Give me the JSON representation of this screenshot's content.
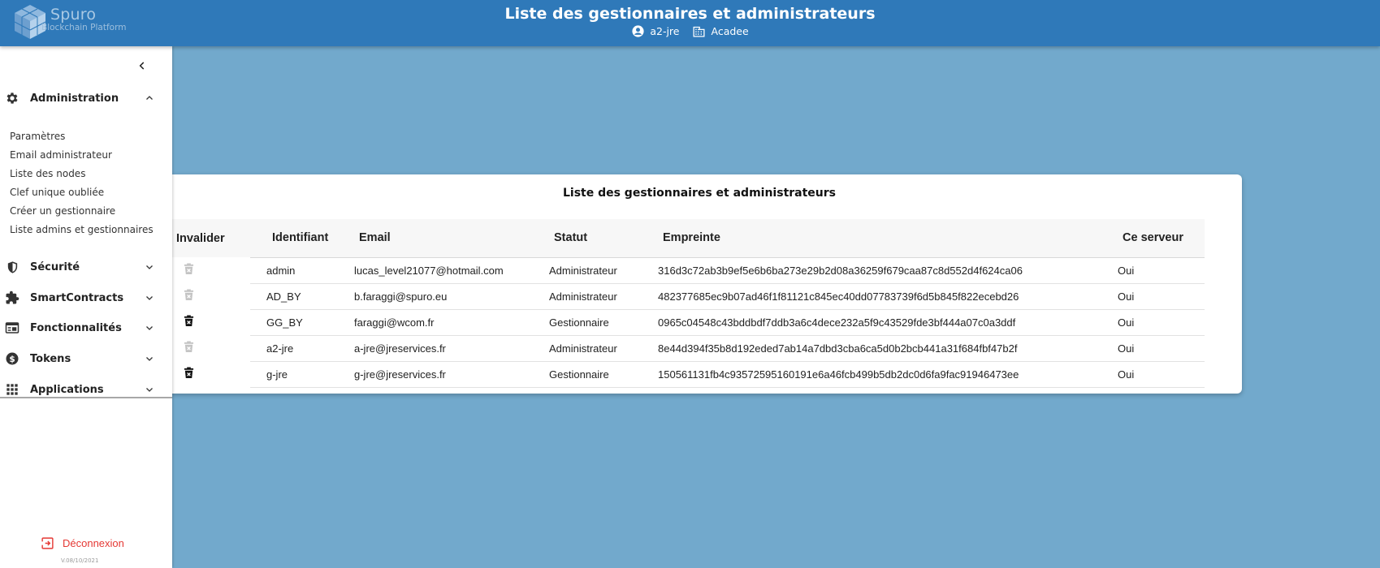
{
  "header": {
    "brand_name": "Spuro",
    "brand_sub": "Blockchain Platform",
    "title": "Liste des gestionnaires et administrateurs",
    "user": "a2-jre",
    "organization": "Acadee"
  },
  "sidebar": {
    "sections": [
      {
        "label": "Administration",
        "icon": "gear-icon",
        "expanded": true
      },
      {
        "label": "Sécurité",
        "icon": "shield-icon",
        "expanded": false
      },
      {
        "label": "SmartContracts",
        "icon": "puzzle-icon",
        "expanded": false
      },
      {
        "label": "Fonctionnalités",
        "icon": "web-window-icon",
        "expanded": false
      },
      {
        "label": "Tokens",
        "icon": "coin-icon",
        "expanded": false
      },
      {
        "label": "Applications",
        "icon": "grid-apps-icon",
        "expanded": false
      }
    ],
    "admin_items": [
      "Paramètres",
      "Email administrateur",
      "Liste des nodes",
      "Clef unique oubliée",
      "Créer un gestionnaire",
      "Liste admins et gestionnaires"
    ],
    "logout": "Déconnexion",
    "version": "V.08/10/2021"
  },
  "card": {
    "title": "Liste des gestionnaires et administrateurs",
    "columns": [
      "Invalider",
      "Identifiant",
      "Email",
      "Statut",
      "Empreinte",
      "Ce serveur"
    ],
    "rows": [
      {
        "invalidate_enabled": false,
        "id": "admin",
        "email": "lucas_level21077@hotmail.com",
        "status": "Administrateur",
        "hash": "316d3c72ab3b9ef5e6b6ba273e29b2d08a36259f679caa87c8d552d4f624ca06",
        "server": "Oui"
      },
      {
        "invalidate_enabled": false,
        "id": "AD_BY",
        "email": "b.faraggi@spuro.eu",
        "status": "Administrateur",
        "hash": "482377685ec9b07ad46f1f81121c845ec40dd07783739f6d5b845f822ecebd26",
        "server": "Oui"
      },
      {
        "invalidate_enabled": true,
        "id": "GG_BY",
        "email": "faraggi@wcom.fr",
        "status": "Gestionnaire",
        "hash": "0965c04548c43bddbdf7ddb3a6c4dece232a5f9c43529fde3bf444a07c0a3ddf",
        "server": "Oui"
      },
      {
        "invalidate_enabled": false,
        "id": "a2-jre",
        "email": "a-jre@jreservices.fr",
        "status": "Administrateur",
        "hash": "8e44d394f35b8d192eded7ab14a7dbd3cba6ca5d0b2bcb441a31f684fbf47b2f",
        "server": "Oui"
      },
      {
        "invalidate_enabled": true,
        "id": "g-jre",
        "email": "g-jre@jreservices.fr",
        "status": "Gestionnaire",
        "hash": "150561131fb4c93572595160191e6a46fcb499b5db2dc0d6fa9fac91946473ee",
        "server": "Oui"
      }
    ]
  },
  "colors": {
    "header_bg": "#2f79b9",
    "page_bg": "#72a9cc",
    "logout_red": "#e53935",
    "trash_enabled": "#111111",
    "trash_disabled": "#c4c4c4"
  }
}
